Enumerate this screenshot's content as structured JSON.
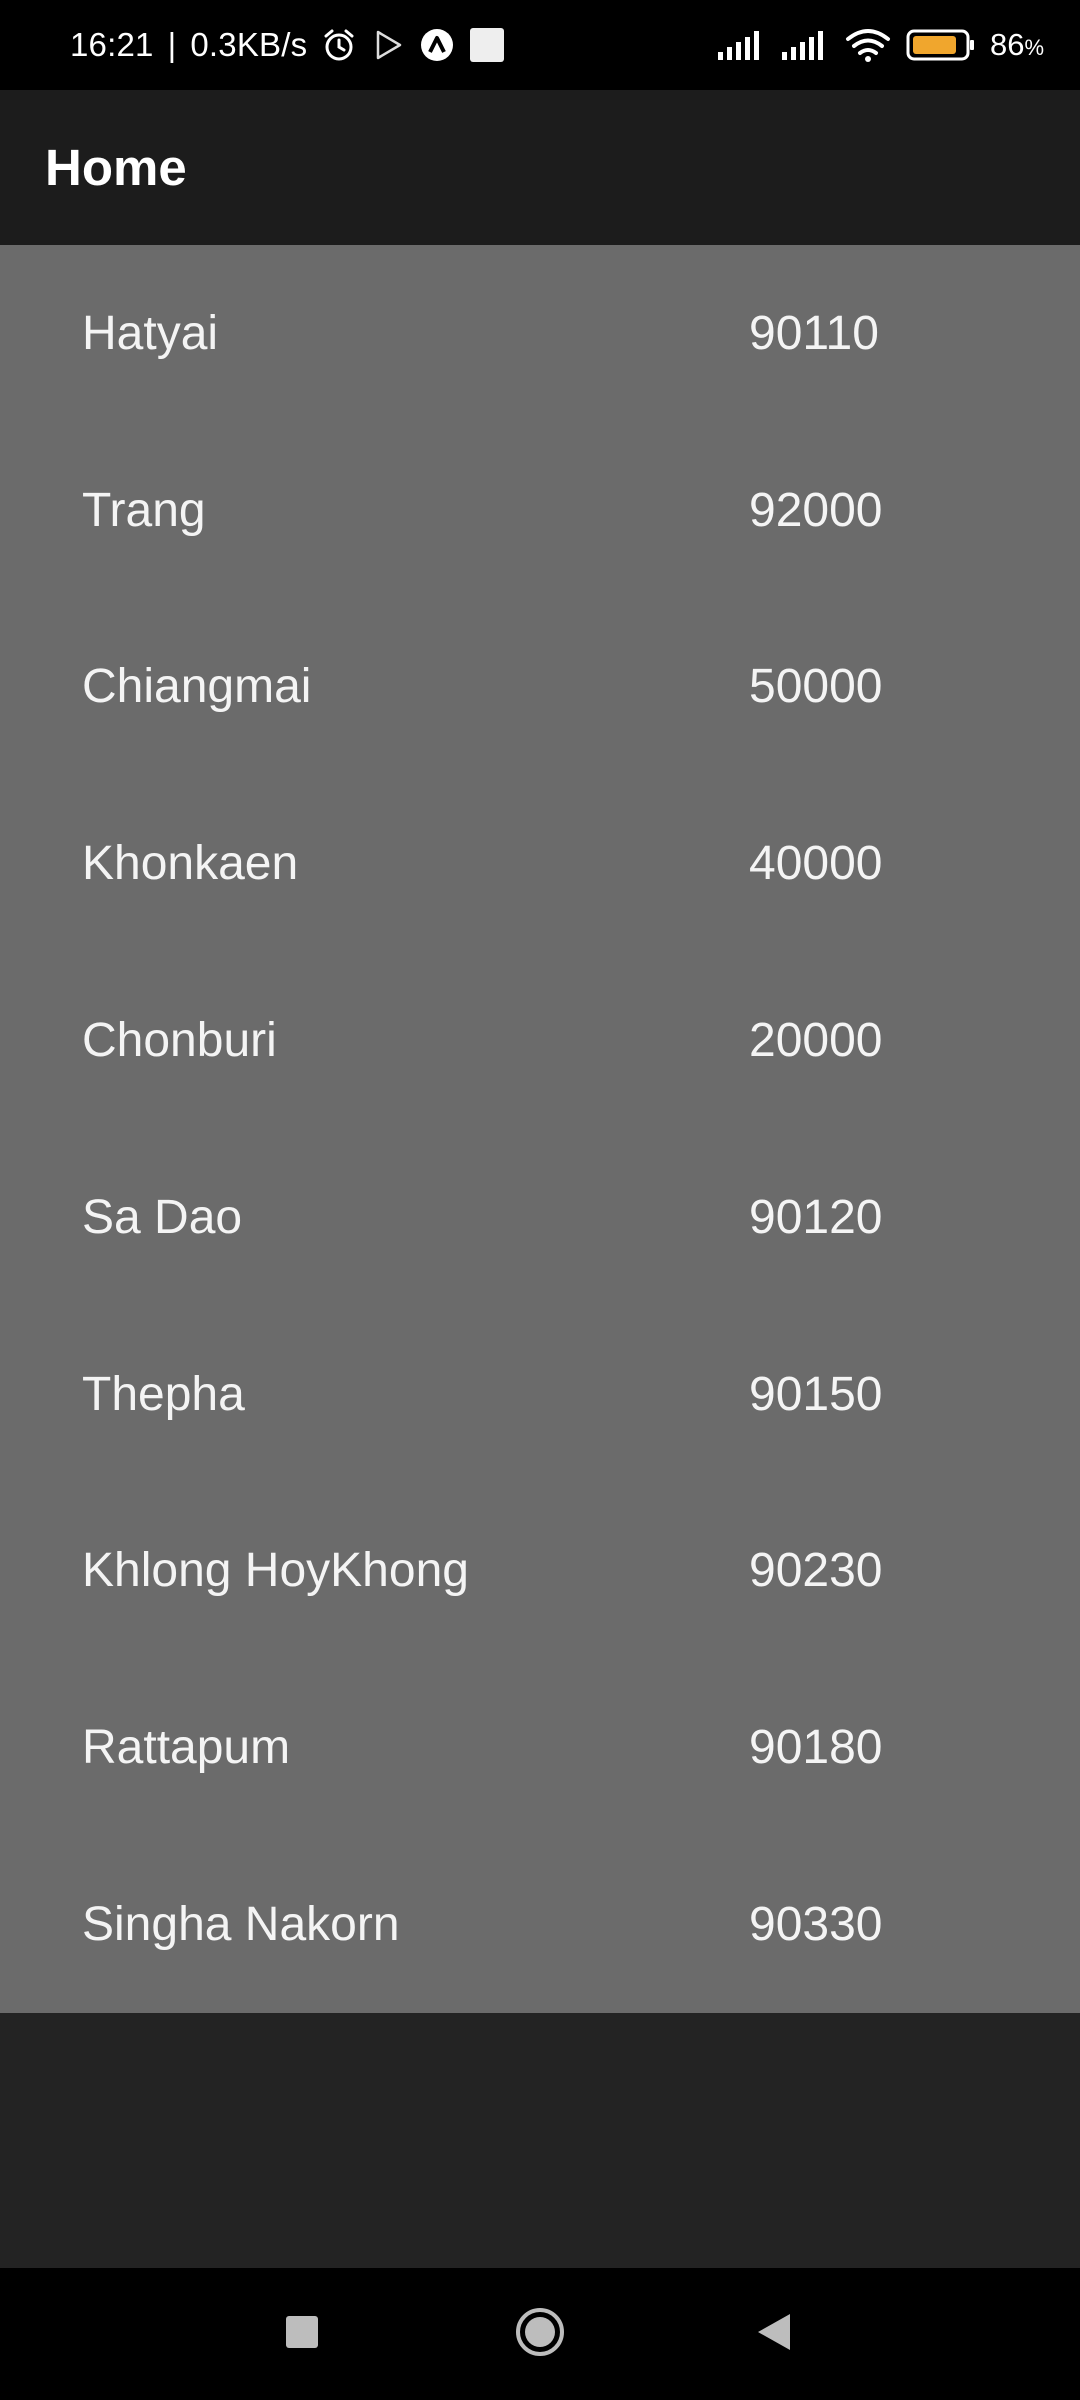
{
  "status_bar": {
    "time": "16:21",
    "separator": "|",
    "speed": "0.3KB/s",
    "battery_percent": "86",
    "battery_unit": "%",
    "battery_level": 0.86,
    "icons": [
      "alarm-icon",
      "play-store-icon",
      "app-a-icon",
      "notification-square-icon",
      "cell-signal-icon",
      "cell-signal-icon",
      "wifi-icon",
      "battery-icon"
    ],
    "battery_color": "#f0a62d"
  },
  "app_bar": {
    "title": "Home"
  },
  "list": {
    "items": [
      {
        "name": "Hatyai",
        "code": "90110"
      },
      {
        "name": "Trang",
        "code": "92000"
      },
      {
        "name": "Chiangmai",
        "code": "50000"
      },
      {
        "name": "Khonkaen",
        "code": "40000"
      },
      {
        "name": "Chonburi",
        "code": "20000"
      },
      {
        "name": "Sa Dao",
        "code": "90120"
      },
      {
        "name": "Thepha",
        "code": "90150"
      },
      {
        "name": "Khlong HoyKhong",
        "code": "90230"
      },
      {
        "name": "Rattapum",
        "code": "90180"
      },
      {
        "name": "Singha Nakorn",
        "code": "90330"
      }
    ]
  },
  "nav_bar": {
    "buttons": [
      "recents-square-icon",
      "home-circle-icon",
      "back-triangle-icon"
    ]
  }
}
